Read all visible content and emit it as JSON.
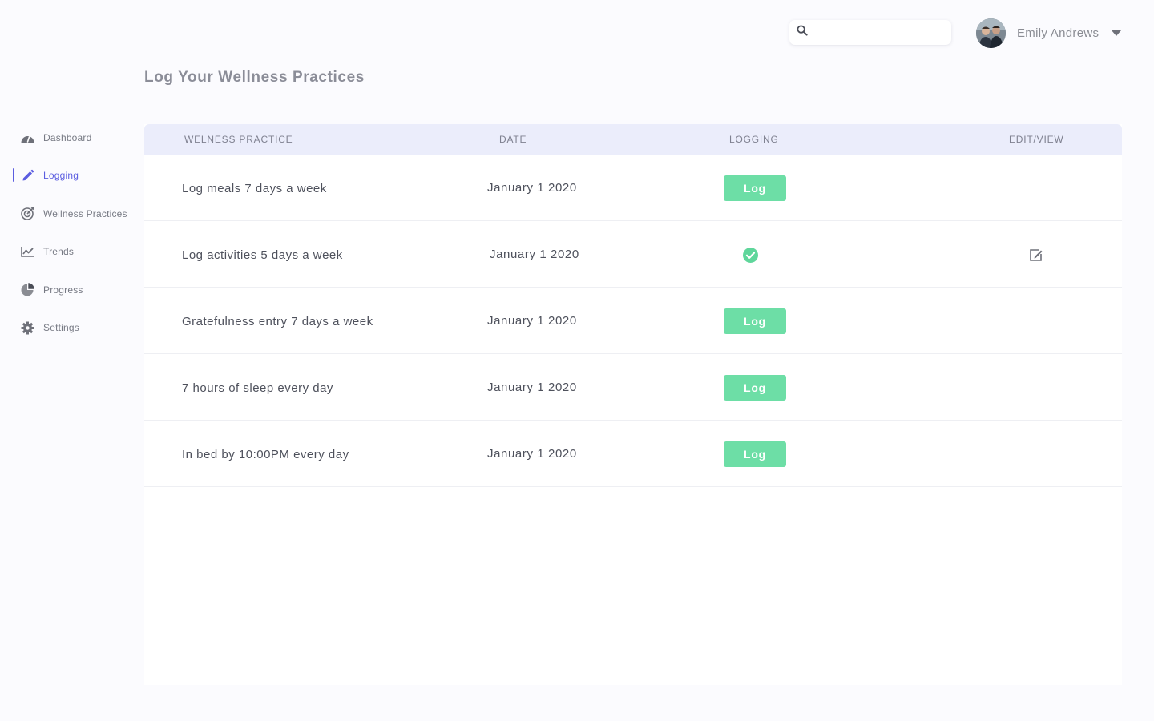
{
  "header": {
    "search_placeholder": "",
    "search_icon": "search-icon",
    "user_name": "Emily Andrews",
    "caret_icon": "caret-down-icon"
  },
  "page_title": "Log Your Wellness Practices",
  "sidebar": {
    "items": [
      {
        "label": "Dashboard",
        "icon": "dashboard-gauge-icon",
        "active": false
      },
      {
        "label": "Logging",
        "icon": "pencil-icon",
        "active": true
      },
      {
        "label": "Wellness Practices",
        "icon": "target-icon",
        "active": false
      },
      {
        "label": "Trends",
        "icon": "trend-chart-icon",
        "active": false
      },
      {
        "label": "Progress",
        "icon": "pie-chart-icon",
        "active": false
      },
      {
        "label": "Settings",
        "icon": "gear-icon",
        "active": false
      }
    ],
    "accent_color": "#5b5de0"
  },
  "table": {
    "headers": {
      "practice": "WELNESS PRACTICE",
      "date": "DATE",
      "logging": "LOGGING",
      "edit_view": "EDIT/VIEW"
    },
    "rows": [
      {
        "practice": "Log meals 7 days a week",
        "date": "January 1 2020",
        "logged": false,
        "log_label": "Log"
      },
      {
        "practice": "Log activities 5 days a week",
        "date": "January 1 2020",
        "logged": true,
        "log_label": ""
      },
      {
        "practice": "Gratefulness entry 7 days a week",
        "date": "January 1 2020",
        "logged": false,
        "log_label": "Log"
      },
      {
        "practice": "7 hours of sleep every day",
        "date": "January 1 2020",
        "logged": false,
        "log_label": "Log"
      },
      {
        "practice": "In bed by 10:00PM every day",
        "date": "January 1 2020",
        "logged": false,
        "log_label": "Log"
      }
    ],
    "log_button_color": "#6ddea6",
    "header_bg_color": "#ebedfb"
  }
}
